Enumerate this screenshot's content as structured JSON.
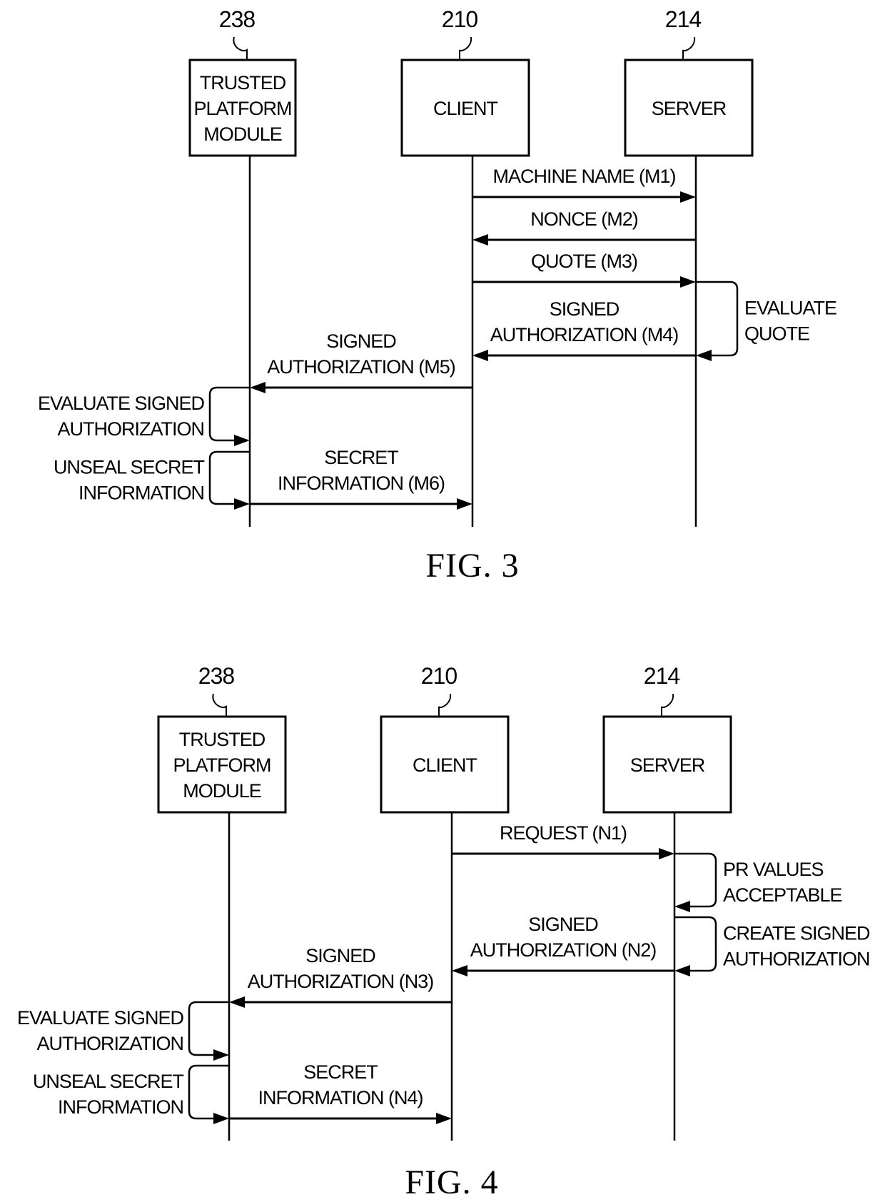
{
  "figures": [
    {
      "id": "fig3",
      "caption": "FIG. 3",
      "participants": [
        {
          "key": "tpm",
          "ref": "238",
          "lines": [
            "TRUSTED",
            "PLATFORM",
            "MODULE"
          ]
        },
        {
          "key": "client",
          "ref": "210",
          "lines": [
            "CLIENT"
          ]
        },
        {
          "key": "server",
          "ref": "214",
          "lines": [
            "SERVER"
          ]
        }
      ],
      "messages": [
        {
          "from": "client",
          "to": "server",
          "lines": [
            "MACHINE NAME (M1)"
          ]
        },
        {
          "from": "server",
          "to": "client",
          "lines": [
            "NONCE (M2)"
          ]
        },
        {
          "from": "client",
          "to": "server",
          "lines": [
            "QUOTE (M3)"
          ]
        },
        {
          "from": "server",
          "to": "client",
          "lines": [
            "SIGNED",
            "AUTHORIZATION (M4)"
          ]
        },
        {
          "from": "client",
          "to": "tpm",
          "lines": [
            "SIGNED",
            "AUTHORIZATION (M5)"
          ]
        },
        {
          "from": "tpm",
          "to": "client",
          "lines": [
            "SECRET",
            "INFORMATION (M6)"
          ]
        }
      ],
      "self_actions": [
        {
          "on": "server",
          "side": "right",
          "lines": [
            "EVALUATE",
            "QUOTE"
          ]
        },
        {
          "on": "tpm",
          "side": "left",
          "lines": [
            "EVALUATE SIGNED",
            "AUTHORIZATION"
          ]
        },
        {
          "on": "tpm",
          "side": "left",
          "lines": [
            "UNSEAL SECRET",
            "INFORMATION"
          ]
        }
      ]
    },
    {
      "id": "fig4",
      "caption": "FIG. 4",
      "participants": [
        {
          "key": "tpm",
          "ref": "238",
          "lines": [
            "TRUSTED",
            "PLATFORM",
            "MODULE"
          ]
        },
        {
          "key": "client",
          "ref": "210",
          "lines": [
            "CLIENT"
          ]
        },
        {
          "key": "server",
          "ref": "214",
          "lines": [
            "SERVER"
          ]
        }
      ],
      "messages": [
        {
          "from": "client",
          "to": "server",
          "lines": [
            "REQUEST (N1)"
          ]
        },
        {
          "from": "server",
          "to": "client",
          "lines": [
            "SIGNED",
            "AUTHORIZATION (N2)"
          ]
        },
        {
          "from": "client",
          "to": "tpm",
          "lines": [
            "SIGNED",
            "AUTHORIZATION (N3)"
          ]
        },
        {
          "from": "tpm",
          "to": "client",
          "lines": [
            "SECRET",
            "INFORMATION (N4)"
          ]
        }
      ],
      "self_actions": [
        {
          "on": "server",
          "side": "right",
          "lines": [
            "PR VALUES",
            "ACCEPTABLE"
          ]
        },
        {
          "on": "server",
          "side": "right",
          "lines": [
            "CREATE SIGNED",
            "AUTHORIZATION"
          ]
        },
        {
          "on": "tpm",
          "side": "left",
          "lines": [
            "EVALUATE SIGNED",
            "AUTHORIZATION"
          ]
        },
        {
          "on": "tpm",
          "side": "left",
          "lines": [
            "UNSEAL SECRET",
            "INFORMATION"
          ]
        }
      ]
    }
  ]
}
